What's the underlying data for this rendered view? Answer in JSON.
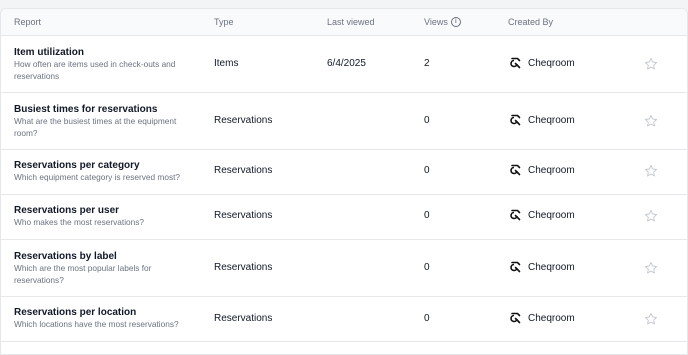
{
  "columns": {
    "report": "Report",
    "type": "Type",
    "last_viewed": "Last viewed",
    "views": "Views",
    "created_by": "Created By"
  },
  "rows": [
    {
      "title": "Item utilization",
      "description": "How often are items used in check-outs and reservations",
      "type": "Items",
      "last_viewed": "6/4/2025",
      "views": "2",
      "created_by": "Cheqroom"
    },
    {
      "title": "Busiest times for reservations",
      "description": "What are the busiest times at the equipment room?",
      "type": "Reservations",
      "last_viewed": "",
      "views": "0",
      "created_by": "Cheqroom"
    },
    {
      "title": "Reservations per category",
      "description": "Which equipment category is reserved most?",
      "type": "Reservations",
      "last_viewed": "",
      "views": "0",
      "created_by": "Cheqroom"
    },
    {
      "title": "Reservations per user",
      "description": "Who makes the most reservations?",
      "type": "Reservations",
      "last_viewed": "",
      "views": "0",
      "created_by": "Cheqroom"
    },
    {
      "title": "Reservations by label",
      "description": "Which are the most popular labels for reservations?",
      "type": "Reservations",
      "last_viewed": "",
      "views": "0",
      "created_by": "Cheqroom"
    },
    {
      "title": "Reservations per location",
      "description": "Which locations have the most reservations?",
      "type": "Reservations",
      "last_viewed": "",
      "views": "0",
      "created_by": "Cheqroom"
    }
  ],
  "icons": {
    "views_info": "info-icon",
    "creator_logo": "cheqroom-logo-icon",
    "favorite": "star-icon"
  },
  "colors": {
    "text_primary": "#111827",
    "text_secondary": "#6b7280",
    "border": "#e5e7eb",
    "header_bg": "#f9fafb",
    "star": "#c4c8cf"
  }
}
